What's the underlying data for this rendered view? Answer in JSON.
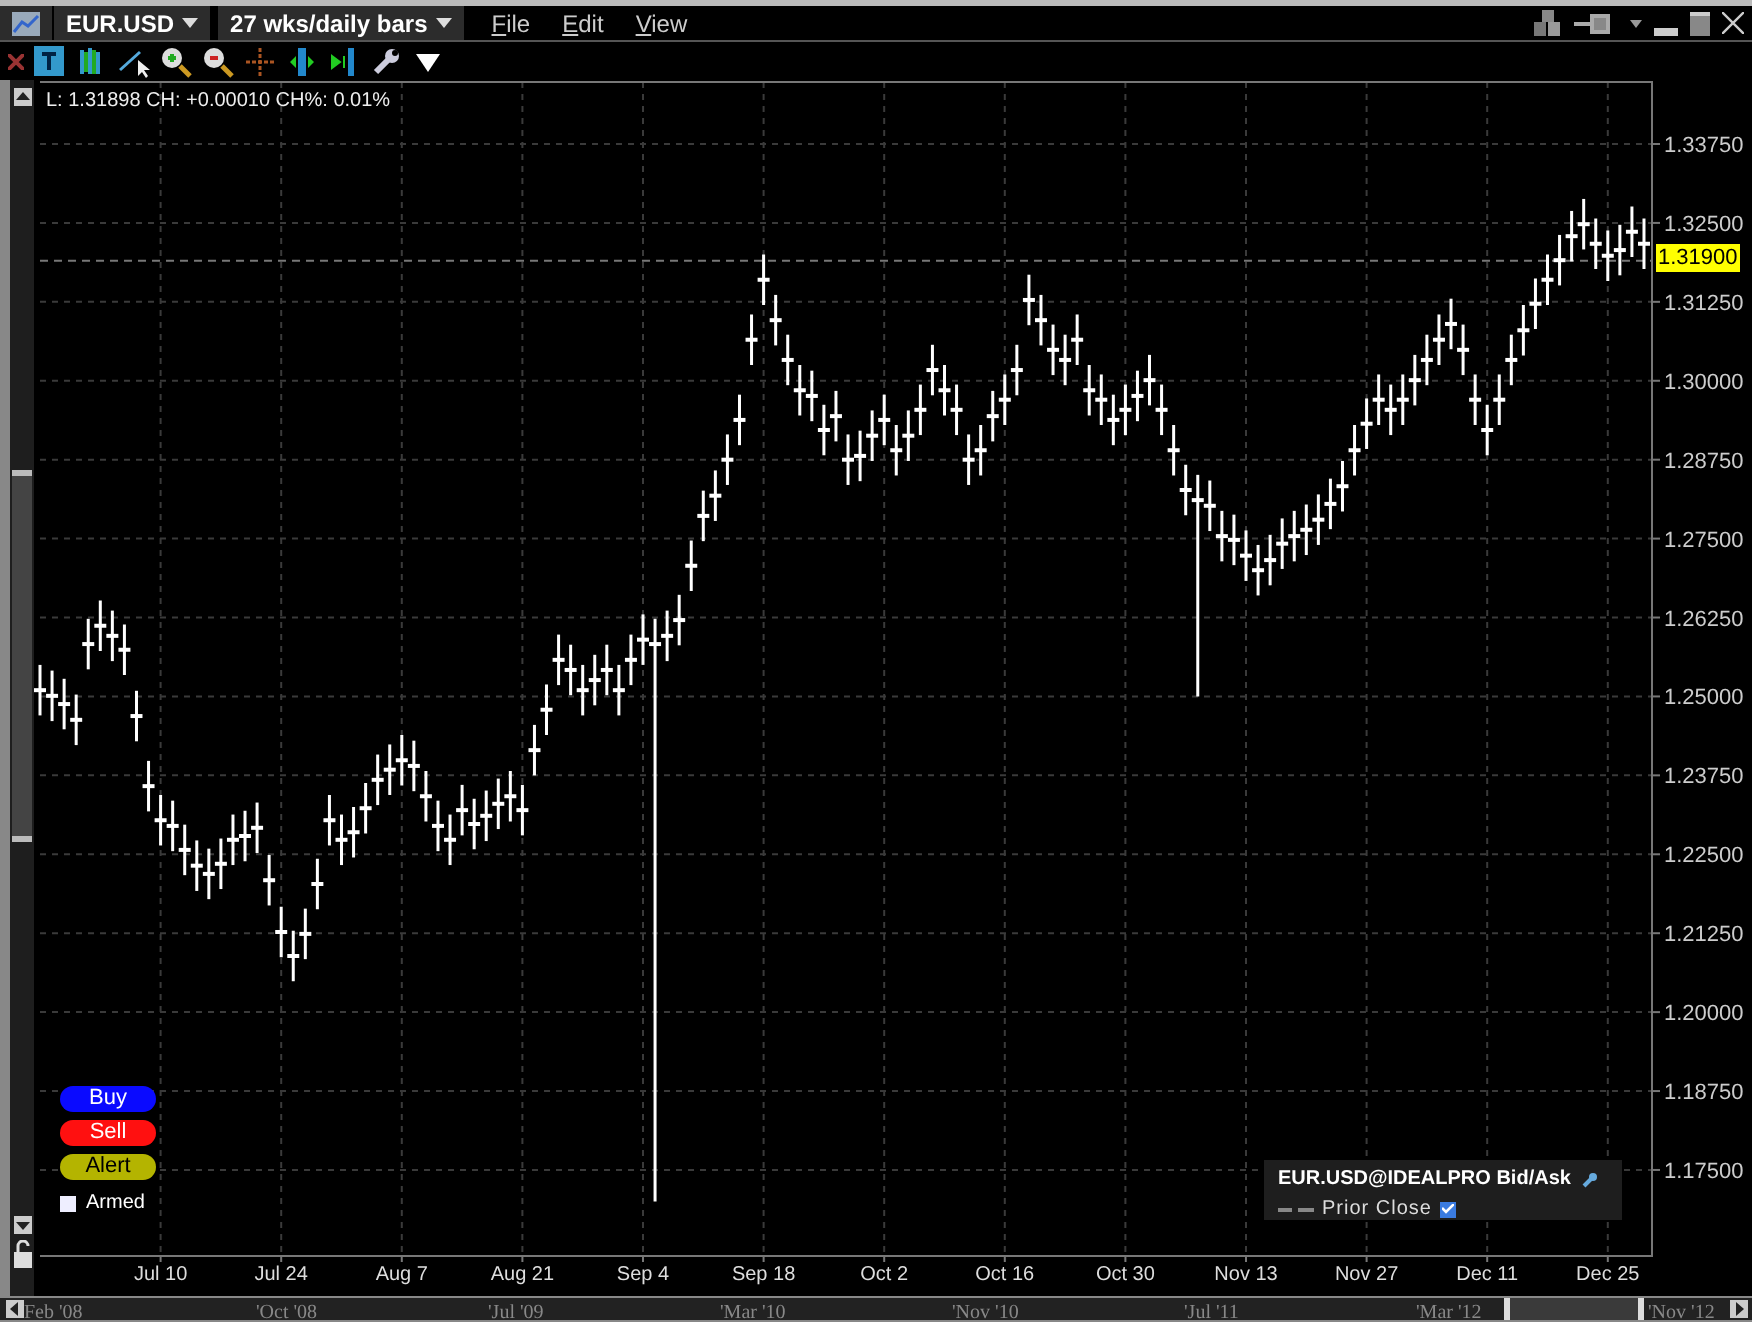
{
  "header": {
    "symbol_tab": "EUR.USD",
    "period_tab": "27 wks/daily bars",
    "menus": [
      "File",
      "Edit",
      "View"
    ]
  },
  "info_line": "L: 1.31898 CH: +0.00010 CH%: 0.01%",
  "order_buttons": [
    {
      "label": "Buy",
      "color": "#0a0aff"
    },
    {
      "label": "Sell",
      "color": "#ff1010"
    },
    {
      "label": "Alert",
      "color": "#b4b400"
    }
  ],
  "armed": {
    "label": "Armed",
    "checked": false
  },
  "legend": {
    "title": "EUR.USD@IDEALPRO Bid/Ask",
    "items": [
      {
        "label": "Prior Close",
        "checked": true
      }
    ]
  },
  "price_axis": {
    "labels": [
      "1.33750",
      "1.32500",
      "1.31250",
      "1.30000",
      "1.28750",
      "1.27500",
      "1.26250",
      "1.25000",
      "1.23750",
      "1.22500",
      "1.21250",
      "1.20000",
      "1.18750",
      "1.17500"
    ],
    "last_price": "1.31900"
  },
  "time_axis": {
    "labels": [
      "Jul 10",
      "Jul 24",
      "Aug 7",
      "Aug 21",
      "Sep 4",
      "Sep 18",
      "Oct 2",
      "Oct 16",
      "Oct 30",
      "Nov 13",
      "Nov 27",
      "Dec 11",
      "Dec 25"
    ]
  },
  "navigator": {
    "labels": [
      "Feb '08",
      "'Oct '08",
      "'Jul '09",
      "'Mar '10",
      "'Nov '10",
      "'Jul '11",
      "'Mar '12",
      "'Nov '12"
    ]
  }
}
